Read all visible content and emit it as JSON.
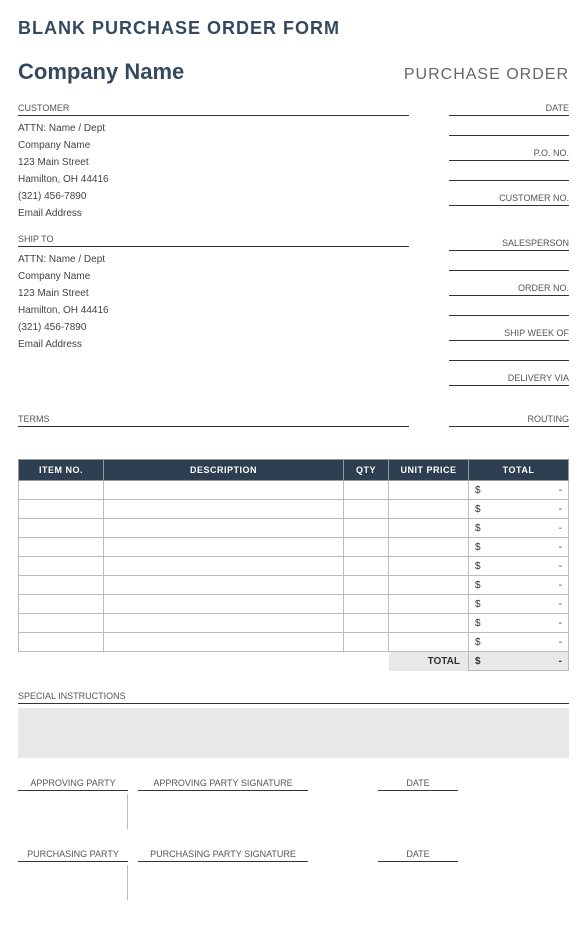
{
  "form_title": "BLANK PURCHASE ORDER FORM",
  "company_name": "Company Name",
  "po_heading": "PURCHASE ORDER",
  "customer": {
    "label": "CUSTOMER",
    "attn": "ATTN: Name / Dept",
    "company": "Company Name",
    "street": "123 Main Street",
    "city": "Hamilton, OH  44416",
    "phone": "(321) 456-7890",
    "email": "Email Address"
  },
  "shipto": {
    "label": "SHIP TO",
    "attn": "ATTN: Name / Dept",
    "company": "Company Name",
    "street": "123 Main Street",
    "city": "Hamilton, OH  44416",
    "phone": "(321) 456-7890",
    "email": "Email Address"
  },
  "right_fields": {
    "date": "DATE",
    "pono": "P.O. NO.",
    "custno": "CUSTOMER NO.",
    "salesperson": "SALESPERSON",
    "orderno": "ORDER NO.",
    "shipweek": "SHIP WEEK OF",
    "delivery": "DELIVERY VIA",
    "routing": "ROUTING"
  },
  "terms_label": "TERMS",
  "table": {
    "headers": {
      "item": "ITEM NO.",
      "desc": "DESCRIPTION",
      "qty": "QTY",
      "price": "UNIT PRICE",
      "total": "TOTAL"
    },
    "currency": "$",
    "dash": "-",
    "total_label": "TOTAL",
    "grand_total": "-"
  },
  "special_label": "SPECIAL INSTRUCTIONS",
  "signatures": {
    "approving_party": "APPROVING PARTY",
    "approving_sig": "APPROVING PARTY SIGNATURE",
    "purchasing_party": "PURCHASING PARTY",
    "purchasing_sig": "PURCHASING PARTY SIGNATURE",
    "date": "DATE"
  }
}
